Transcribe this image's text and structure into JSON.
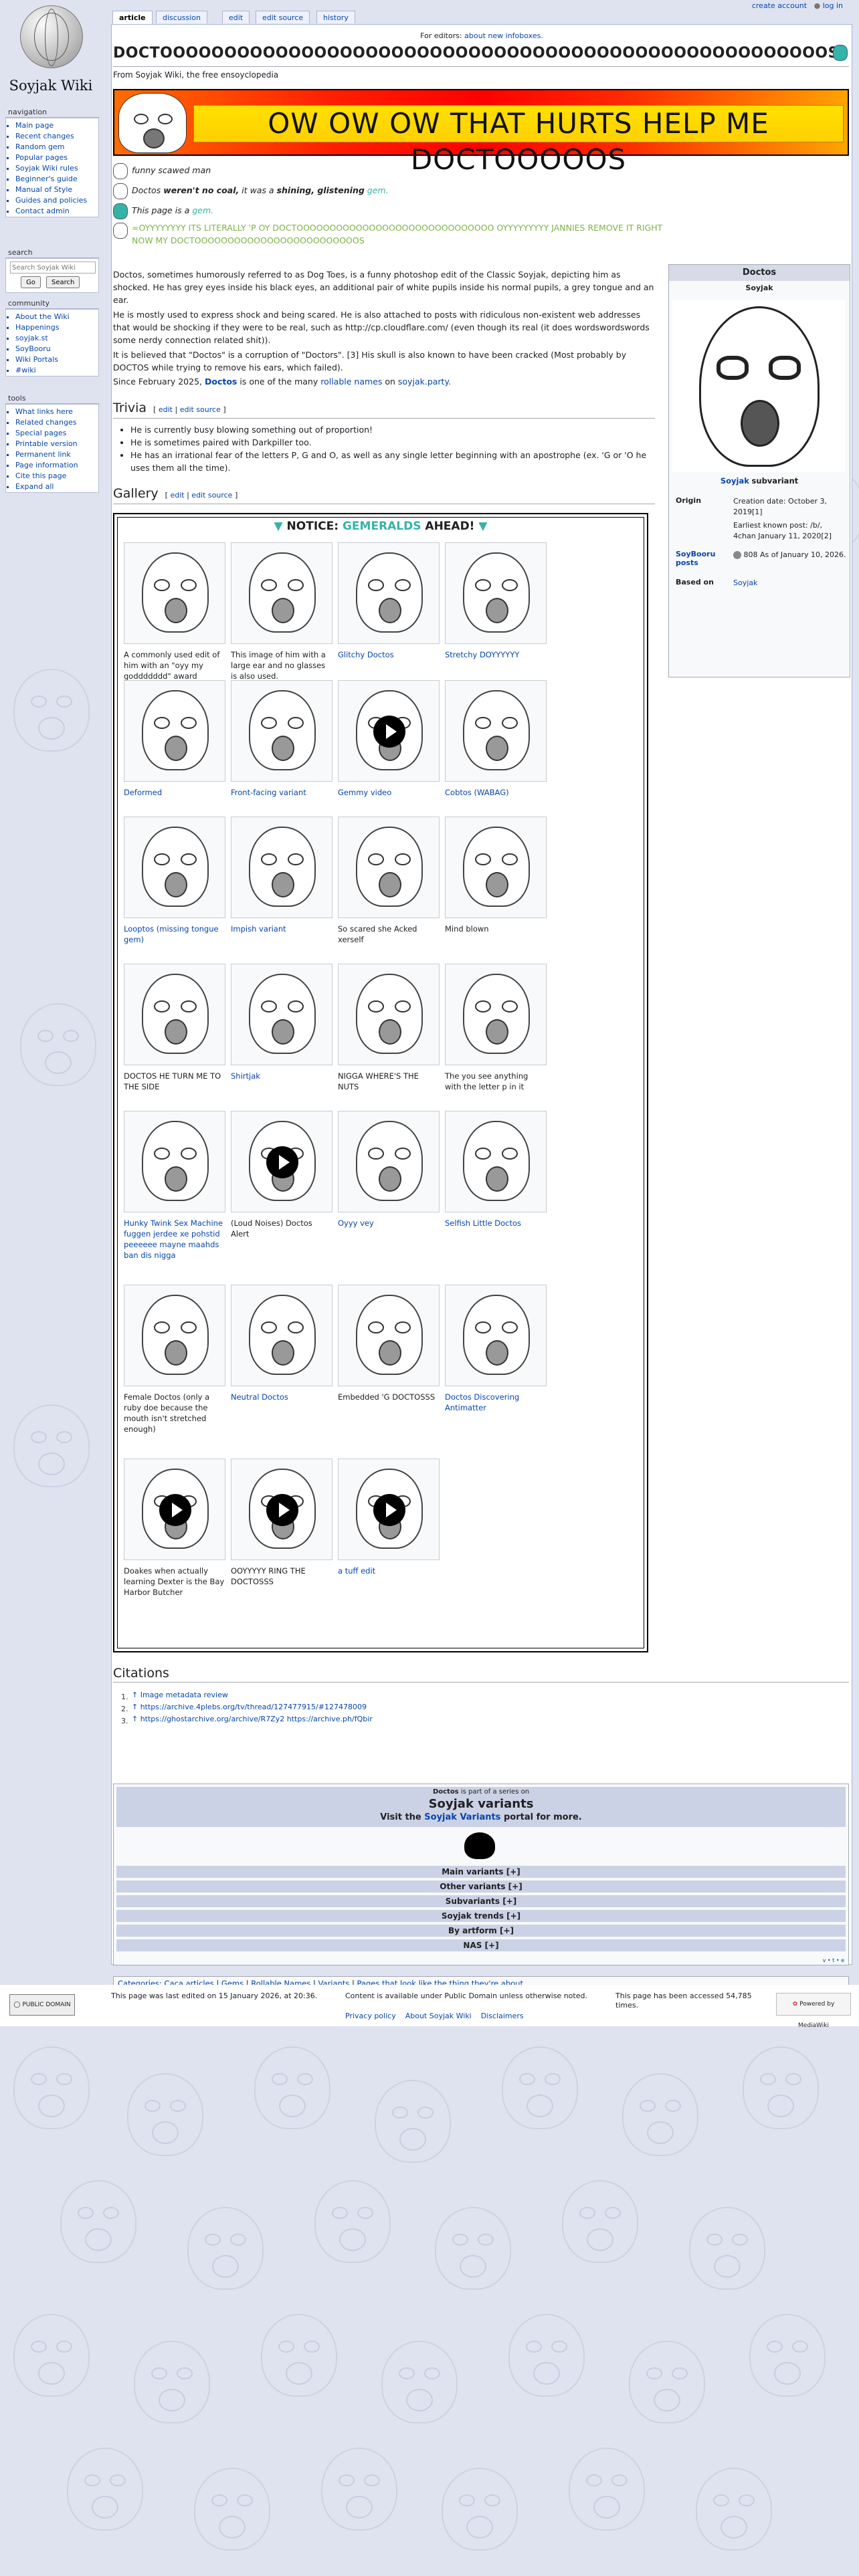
{
  "personal": {
    "create": "create account",
    "login": "log in"
  },
  "tabs": {
    "article": "article",
    "discussion": "discussion",
    "edit": "edit",
    "edit_source": "edit source",
    "history": "history"
  },
  "logo": {
    "text": "Soyjak Wiki"
  },
  "nav": {
    "title": "navigation",
    "items": [
      "Main page",
      "Recent changes",
      "Random gem",
      "Popular pages",
      "Soyjak Wiki rules",
      "Beginner's guide",
      "Manual of Style",
      "Guides and policies",
      "Contact admin"
    ]
  },
  "search": {
    "title": "search",
    "placeholder": "Search Soyjak Wiki",
    "go": "Go",
    "search": "Search"
  },
  "community": {
    "title": "community",
    "items": [
      "About the Wiki",
      "Happenings",
      "soyjak.st",
      "SoyBooru",
      "Wiki Portals",
      "#wiki"
    ]
  },
  "tools": {
    "title": "tools",
    "items": [
      "What links here",
      "Related changes",
      "Special pages",
      "Printable version",
      "Permanent link",
      "Page information",
      "Cite this page",
      "Expand all"
    ]
  },
  "page": {
    "editors_label": "For editors:",
    "editors_link": "about new infoboxes.",
    "title": "DOCTOOOOOOOOOOOOOOOOOOOOOOOOOOOOOOOOOOOOOOOOOOOOOOOOOOOOS",
    "subtitle": "From Soyjak Wiki, the free ensoyclopedia",
    "banner": "OW OW OW THAT HURTS HELP ME DOCTOOOOOS",
    "notice1": "funny scawed man",
    "notice2_a": "Doctos",
    "notice2_b": "weren't no coal,",
    "notice2_c": "it was a",
    "notice2_d": "shining, glistening",
    "notice2_e": "gem.",
    "notice3_a": "This page is a",
    "notice3_b": "gem.",
    "notice4": "=OYYYYYYYY ITS LITERALLY 'P OY DOCTOOOOOOOOOOOOOOOOOOOOOOOOOOOOOO OYYYYYYYYY JANNIES REMOVE IT RIGHT NOW MY DOCTOOOOOOOOOOOOOOOOOOOOOOOOOS"
  },
  "intro": {
    "p1": "Doctos, sometimes humorously referred to as Dog Toes, is a funny photoshop edit of the Classic Soyjak, depicting him as shocked. He has grey eyes inside his black eyes, an additional pair of white pupils inside his normal pupils, a grey tongue and an ear.",
    "p2": "He is mostly used to express shock and being scared. He is also attached to posts with ridiculous non-existent web addresses that would be shocking if they were to be real, such as http://cp.cloudflare.com/ (even though its real (it does wordswordswords some nerdy connection related shit)).",
    "p3": "It is believed that \"Doctos\" is a corruption of \"Doctors\". [3] His skull is also known to have been cracked (Most probably by DOCTOS while trying to remove his ears, which failed).",
    "p4_a": "Since February 2025,",
    "p4_b": "Doctos",
    "p4_c": "is one of the many",
    "p4_d": "rollable names",
    "p4_e": "on",
    "p4_f": "soyjak.party."
  },
  "trivia": {
    "heading": "Trivia",
    "edit": "edit",
    "edit_source": "edit source",
    "items": [
      "He is currently busy blowing something out of proportion!",
      "He is sometimes paired with Darkpiller too.",
      "He has an irrational fear of the letters P, G and O, as well as any single letter beginning with an apostrophe (ex. 'G or 'O he uses them all the time)."
    ]
  },
  "gallery": {
    "heading": "Gallery",
    "edit": "edit",
    "edit_source": "edit source",
    "notice_a": "NOTICE:",
    "notice_b": "GEMERALDS",
    "notice_c": "AHEAD!",
    "items": [
      {
        "caption": "A commonly used edit of him with an \"oyy my goddddddd\" award",
        "link": false,
        "video": false
      },
      {
        "caption": "This image of him with a large ear and no glasses is also used.",
        "link": false,
        "video": false
      },
      {
        "caption": "Glitchy Doctos",
        "link": true,
        "video": false
      },
      {
        "caption": "Stretchy DOYYYYYY",
        "link": true,
        "video": false
      },
      {
        "caption": "Deformed",
        "link": true,
        "video": false
      },
      {
        "caption": "Front-facing variant",
        "link": true,
        "video": false
      },
      {
        "caption": "Gemmy video",
        "link": true,
        "video": true
      },
      {
        "caption": "Cobtos (WABAG)",
        "link": true,
        "video": false
      },
      {
        "caption": "Looptos (missing tongue gem)",
        "link": true,
        "video": false
      },
      {
        "caption": "Impish variant",
        "link": true,
        "video": false
      },
      {
        "caption": "So scared she Acked xerself",
        "link": false,
        "video": false
      },
      {
        "caption": "Mind blown",
        "link": false,
        "video": false
      },
      {
        "caption": "DOCTOS HE TURN ME TO THE SIDE",
        "link": false,
        "video": false
      },
      {
        "caption": "Shirtjak",
        "link": true,
        "video": false
      },
      {
        "caption": "NIGGA WHERE'S THE NUTS",
        "link": false,
        "video": false
      },
      {
        "caption": "The you see anything with the letter p in it",
        "link": false,
        "video": false
      },
      {
        "caption": "Hunky Twink Sex Machine fuggen jerdee xe pohstid peeeeee mayne maahds ban dis nigga",
        "link": true,
        "video": false
      },
      {
        "caption": "(Loud Noises) Doctos Alert",
        "link": false,
        "video": true
      },
      {
        "caption": "Oyyy vey",
        "link": true,
        "video": false
      },
      {
        "caption": "Selfish Little Doctos",
        "link": true,
        "video": false
      },
      {
        "caption": "Female Doctos (only a ruby doe because the mouth isn't stretched enough)",
        "link": false,
        "video": false
      },
      {
        "caption": "Neutral Doctos",
        "link": true,
        "video": false
      },
      {
        "caption": "Embedded 'G DOCTOSSS",
        "link": false,
        "video": false
      },
      {
        "caption": "Doctos Discovering Antimatter",
        "link": true,
        "video": false
      },
      {
        "caption": "Doakes when actually learning Dexter is the Bay Harbor Butcher",
        "link": false,
        "video": true
      },
      {
        "caption": "OOYYYYY RING THE DOCTOSSS",
        "link": false,
        "video": true
      },
      {
        "caption": "a tuff edit",
        "link": true,
        "video": true
      }
    ]
  },
  "infobox": {
    "title": "Doctos",
    "parent": "Soyjak",
    "caption_a": "Soyjak",
    "caption_b": "subvariant",
    "origin_label": "Origin",
    "origin_1": "Creation date: October 3, 2019[1]",
    "origin_2": "Earliest known post: /b/, 4chan January 11, 2020[2]",
    "booru_label": "SoyBooru posts",
    "booru_value": "808 As of January 10, 2026.",
    "based_label": "Based on",
    "based_value": "Soyjak"
  },
  "citations": {
    "heading": "Citations",
    "items": [
      "↑ Image metadata review",
      "↑ https://archive.4plebs.org/tv/thread/127477915/#127478009",
      "↑ https://ghostarchive.org/archive/R7Zy2 https://archive.ph/fQbir"
    ]
  },
  "navbox": {
    "part_a": "Doctos",
    "part_b": "is part of a series on",
    "title": "Soyjak variants",
    "visit_a": "Visit the",
    "visit_b": "Soyjak Variants",
    "visit_c": "portal for more.",
    "rows": [
      "Main variants [+]",
      "Other variants [+]",
      "Subvariants [+]",
      "Soyjak trends [+]",
      "By artform [+]",
      "NAS [+]"
    ],
    "vte": "v • t • e"
  },
  "categories": {
    "label": "Categories:",
    "items": [
      "Caca articles",
      "Gems",
      "Rollable Names",
      "Variants",
      "Pages that look like the thing they're about"
    ]
  },
  "footer": {
    "pd": "PUBLIC DOMAIN",
    "edited": "This page was last edited on 15 January 2026, at 20:36.",
    "content": "Content is available under Public Domain unless otherwise noted.",
    "accessed": "This page has been accessed 54,785 times.",
    "links": [
      "Privacy policy",
      "About Soyjak Wiki",
      "Disclaimers"
    ],
    "powered": "Powered by MediaWiki"
  },
  "colors": {
    "accent_link": "#0645ad",
    "gem": "#36b3a8",
    "green_notice": "#7cb342",
    "banner_red": "#ff1e00",
    "banner_yellow": "#ffd000"
  }
}
